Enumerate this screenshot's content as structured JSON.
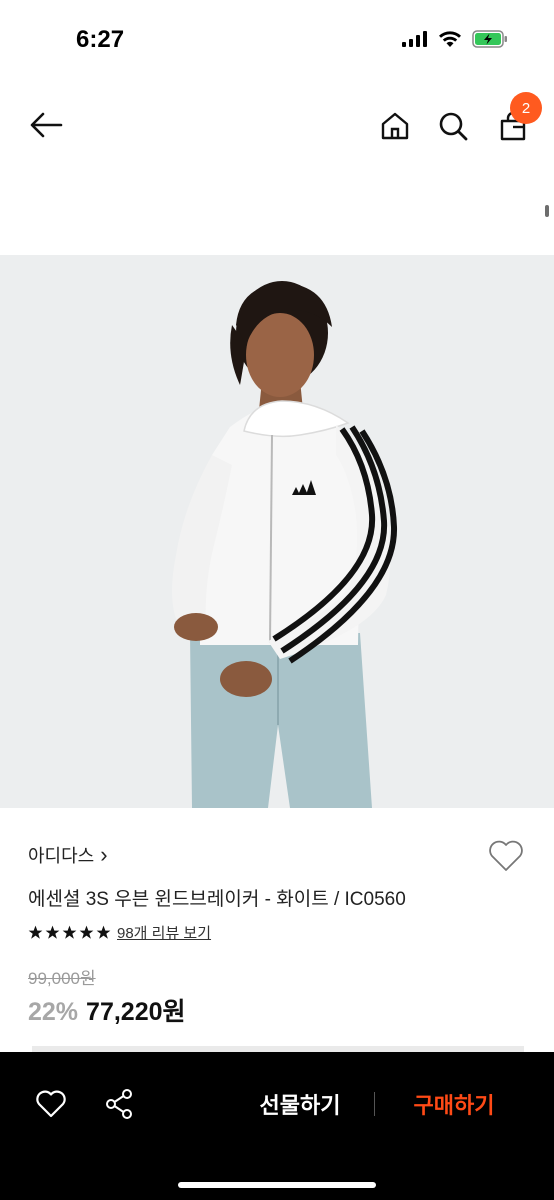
{
  "status": {
    "time": "6:27",
    "icons": [
      "cellular-signal-icon",
      "wifi-icon",
      "battery-charging-icon"
    ]
  },
  "nav": {
    "icons": [
      "back-arrow-icon",
      "home-icon",
      "search-icon",
      "shopping-bag-icon"
    ],
    "cart_count": "2"
  },
  "hero": {
    "image_description": "product-photo-windbreaker",
    "background_color": "#eceeef"
  },
  "product": {
    "brand": "아디다스",
    "brand_chevron": "›",
    "name": "에센셜 3S 우븐 윈드브레이커 - 화이트 / IC0560",
    "rating_stars": 5,
    "review_link": "98개 리뷰 보기",
    "original_price": "99,000원",
    "discount": "22%",
    "price": "77,220원"
  },
  "bottom_bar": {
    "gift_label": "선물하기",
    "buy_label": "구매하기",
    "buy_color": "#ff4a16"
  }
}
